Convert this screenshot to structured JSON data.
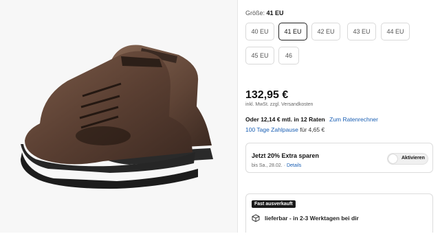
{
  "size": {
    "label": "Größe:",
    "selected": "41 EU"
  },
  "sizes": [
    "40 EU",
    "41 EU",
    "42 EU",
    "43 EU",
    "44 EU",
    "45 EU",
    "46"
  ],
  "price": {
    "amount": "132,95 €",
    "vat_text": "inkl. MwSt. zzgl.",
    "shipping_link": "Versandkosten"
  },
  "installments": {
    "text": "Oder 12,14 € mtl. in 12 Raten",
    "calc_link": "Zum Ratenrechner",
    "pause_link": "100 Tage Zahlpause",
    "pause_text": "für 4,65 €"
  },
  "promo": {
    "title": "Jetzt 20% Extra sparen",
    "until": "bis Sa., 28.02. ·",
    "details_link": "Details",
    "toggle_label": "Aktivieren"
  },
  "stock": {
    "badge": "Fast ausverkauft",
    "delivery": "lieferbar - in 2-3 Werktagen bei dir"
  },
  "colors": {
    "link": "#1a5fb4",
    "badge_bg": "#1a1a1a",
    "selected_border": "#222222"
  }
}
